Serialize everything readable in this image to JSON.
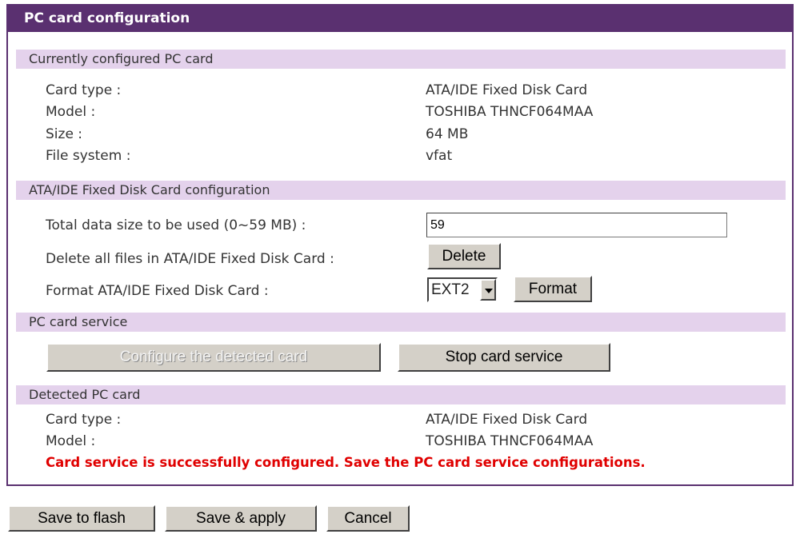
{
  "header": {
    "title": "PC card configuration"
  },
  "current_card": {
    "section_title": "Currently configured PC card",
    "rows": [
      {
        "label": "Card type :",
        "value": "ATA/IDE Fixed Disk Card"
      },
      {
        "label": "Model :",
        "value": "TOSHIBA THNCF064MAA"
      },
      {
        "label": "Size :",
        "value": "64 MB"
      },
      {
        "label": "File system :",
        "value": "vfat"
      }
    ]
  },
  "disk_config": {
    "section_title": "ATA/IDE Fixed Disk Card configuration",
    "total_size_label": "Total data size to be used (0~59 MB) :",
    "total_size_value": "59",
    "delete_label": "Delete all files in ATA/IDE Fixed Disk Card :",
    "delete_button": "Delete",
    "format_label": "Format ATA/IDE Fixed Disk Card :",
    "format_select_value": "EXT2",
    "format_button": "Format"
  },
  "service": {
    "section_title": "PC card service",
    "configure_button": "Configure the detected card",
    "stop_button": "Stop card service"
  },
  "detected_card": {
    "section_title": "Detected PC card",
    "rows": [
      {
        "label": "Card type :",
        "value": "ATA/IDE Fixed Disk Card"
      },
      {
        "label": "Model :",
        "value": "TOSHIBA THNCF064MAA"
      }
    ],
    "status_message": "Card service is successfully configured. Save the PC card service configurations.",
    "status_color": "#e00000"
  },
  "footer": {
    "save_flash_button": "Save to flash",
    "save_apply_button": "Save & apply",
    "cancel_button": "Cancel"
  },
  "colors": {
    "header_bg": "#5a3070",
    "section_bg": "#e4d2ec",
    "button_face": "#d4d0c8"
  }
}
